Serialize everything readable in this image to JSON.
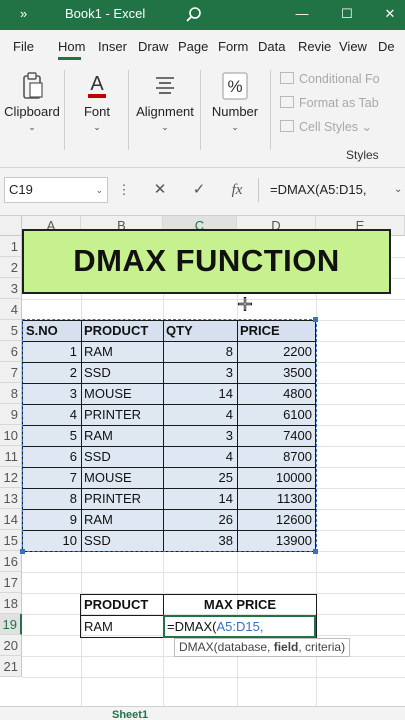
{
  "window": {
    "more_glyph": "»",
    "title": "Book1 - Excel",
    "search_glyph": "⌕",
    "minimize_glyph": "—",
    "maximize_glyph": "☐",
    "close_glyph": "✕"
  },
  "ribbon_tabs": [
    "File",
    "Hom",
    "Inser",
    "Draw",
    "Page",
    "Form",
    "Data",
    "Revie",
    "View",
    "De"
  ],
  "active_tab": "Hom",
  "ribbon": {
    "clipboard": "Clipboard",
    "font": "Font",
    "font_glyph": "A",
    "alignment": "Alignment",
    "number": "Number",
    "number_glyph": "%",
    "chevron": "⌄",
    "conditional_formatting": "Conditional Fo",
    "format_as_table": "Format as Tab",
    "cell_styles": "Cell Styles",
    "cell_styles_chevron": "⌄",
    "styles_group": "Styles"
  },
  "formula_bar": {
    "name_box": "C19",
    "name_box_chevron": "⌄",
    "more_glyph": "⋮",
    "cancel_glyph": "✕",
    "enter_glyph": "✓",
    "fx_glyph": "fx",
    "formula": "=DMAX(A5:D15,",
    "expand_glyph": "⌄"
  },
  "columns": [
    "A",
    "B",
    "C",
    "D",
    "E"
  ],
  "rows": [
    "1",
    "2",
    "3",
    "4",
    "5",
    "6",
    "7",
    "8",
    "9",
    "10",
    "11",
    "12",
    "13",
    "14",
    "15",
    "16",
    "17",
    "18",
    "19",
    "20",
    "21"
  ],
  "banner": "DMAX FUNCTION",
  "table": {
    "headers": [
      "S.NO",
      "PRODUCT",
      "QTY",
      "PRICE"
    ],
    "rows": [
      [
        "1",
        "RAM",
        "8",
        "2200"
      ],
      [
        "2",
        "SSD",
        "3",
        "3500"
      ],
      [
        "3",
        "MOUSE",
        "14",
        "4800"
      ],
      [
        "4",
        "PRINTER",
        "4",
        "6100"
      ],
      [
        "5",
        "RAM",
        "3",
        "7400"
      ],
      [
        "6",
        "SSD",
        "4",
        "8700"
      ],
      [
        "7",
        "MOUSE",
        "25",
        "10000"
      ],
      [
        "8",
        "PRINTER",
        "14",
        "11300"
      ],
      [
        "9",
        "RAM",
        "26",
        "12600"
      ],
      [
        "10",
        "SSD",
        "38",
        "13900"
      ]
    ]
  },
  "criteria": {
    "header_product": "PRODUCT",
    "header_max_price": "MAX PRICE",
    "product_value": "RAM",
    "cell_prefix": "=DMAX(",
    "cell_ref": "A5:D15,"
  },
  "tooltip": {
    "func": "DMAX(",
    "arg1": "database, ",
    "arg2": "field",
    "arg3": ", criteria)"
  },
  "colors": {
    "excel_green": "#217346",
    "banner_fill": "#c7f08e",
    "table_fill": "#dfe7f2",
    "range_blue": "#3a6fc4"
  },
  "sheet_tab": "Sheet1"
}
